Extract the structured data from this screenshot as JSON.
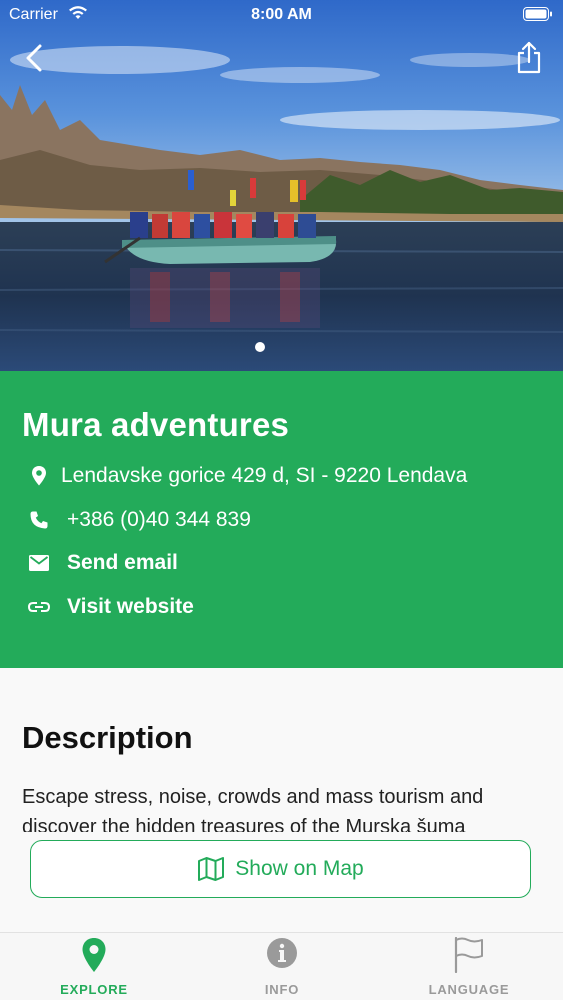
{
  "status_bar": {
    "carrier": "Carrier",
    "time": "8:00 AM"
  },
  "hero": {
    "image_subject": "rafting group paddling on a river",
    "page_indicator": {
      "count": 1,
      "current": 1
    }
  },
  "place": {
    "title": "Mura adventures",
    "address": "Lendavske gorice 429 d, SI - 9220 Lendava",
    "phone": "+386 (0)40 344 839",
    "email_label": "Send email",
    "website_label": "Visit website"
  },
  "description": {
    "heading": "Description",
    "text": "Escape stress, noise, crowds and mass tourism and discover the hidden treasures of the Murska šuma"
  },
  "map_button": {
    "label": "Show on Map"
  },
  "tabs": [
    {
      "label": "EXPLORE",
      "icon": "pin-icon",
      "active": true
    },
    {
      "label": "INFO",
      "icon": "info-icon",
      "active": false
    },
    {
      "label": "LANGUAGE",
      "icon": "flag-icon",
      "active": false
    }
  ],
  "colors": {
    "accent": "#23ab5a",
    "tab_inactive": "#9a9a9a",
    "description_bg": "#f9f9f9"
  }
}
